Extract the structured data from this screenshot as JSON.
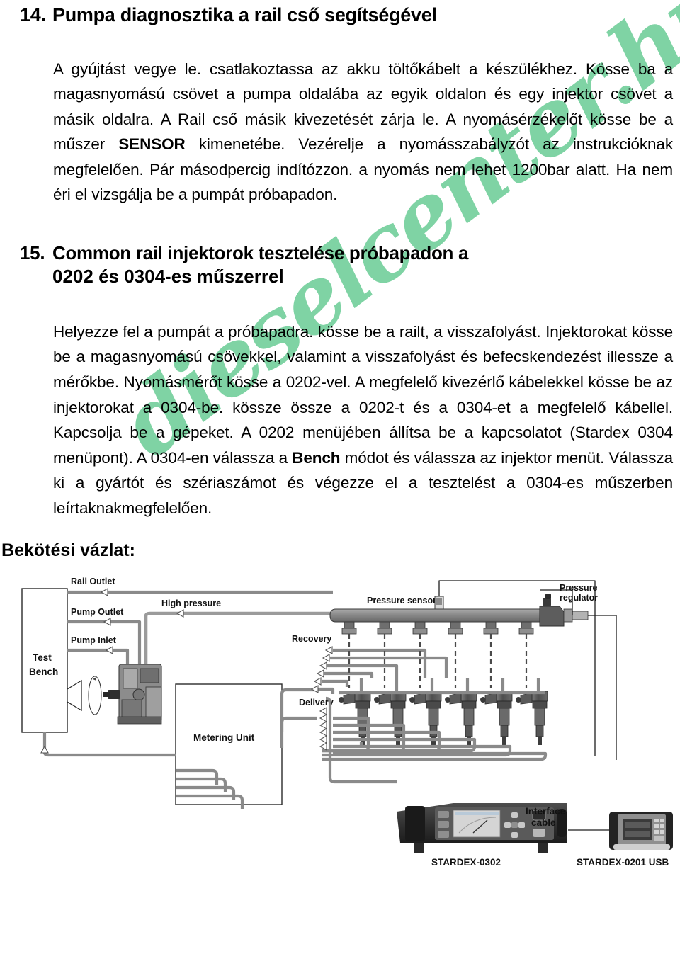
{
  "watermark": {
    "text": "dieselcenter.hu",
    "color": "#7fd3a4"
  },
  "sections": [
    {
      "number": "14.",
      "title": "Pumpa diagnosztika a rail cső segítségével",
      "paragraphs": [
        "A gyújtást vegye le. csatlakoztassa az akku töltőkábelt a készülékhez. Kösse ba a magasnyomású csövet a pumpa oldalába az egyik oldalon és egy injektor csövet a másik oldalra. A Rail cső másik kivezetését zárja le.",
        "A nyomásérzékelőt kösse be a műszer SENSOR kimenetébe. Vezérelje a nyomásszabályzót az instrukcióknak megfelelően. Pár másodpercig indítózzon. a nyomás nem lehet 1200bar alatt. Ha nem éri el vizsgálja be a pumpát próbapadon."
      ],
      "para_bold_term": "SENSOR"
    },
    {
      "number": "15.",
      "title_line1": "Common rail injektorok tesztelése próbapadon a",
      "title_line2": "0202 és 0304-es műszerrel",
      "paragraph": "Helyezze fel a pumpát a próbapadra. kösse be a railt, a visszafolyást. Injektorokat kösse be a magasnyomású csövekkel, valamint a visszafolyást és befecskendezést illessze a mérőkbe. Nyomásmérőt kösse a 0202-vel. A megfelelő kivezérlő kábelekkel kösse be az injektorokat a 0304-be. kössze össze a 0202-t és a 0304-et a megfelelő kábellel. Kapcsolja be a gépeket. A 0202 menüjében állítsa be a kapcsolatot (Stardex 0304 menüpont). A 0304-en válassza a Bench módot és válassza az injektor menüt. Válassza ki a gyártót és szériaszámot és végezze el a tesztelést a 0304-es műszerben leírtaknakmegfelelően.",
      "para_bold_term": "Bench"
    }
  ],
  "heading_14_number": "14.",
  "heading_14_title": "Pumpa diagnosztika a rail cső segítségével",
  "heading_15_number": "15.",
  "heading_15_title_l1": "Common rail injektorok tesztelése próbapadon a",
  "heading_15_title_l2": "0202 és 0304-es műszerrel",
  "para_14_a_part1": "A gyújtást vegye le. csatlakoztassa az akku töltőkábelt a készülékhez. Kösse ba a magasnyomású csövet a pumpa oldalába az egyik oldalon és egy injektor csövet a másik oldalra. A Rail cső másik kivezetését zárja le. A nyomásérzékelőt kösse be a műszer ",
  "para_14_a_bold": "SENSOR",
  "para_14_a_part2": " kimenetébe. Vezérelje a nyomásszabályzót az instrukcióknak megfelelően. Pár másodpercig indítózzon. a nyomás nem lehet 1200bar alatt. Ha nem éri el vizsgálja be a pumpát próbapadon.",
  "para_15_part1": "Helyezze fel a pumpát a próbapadra. kösse be a railt, a visszafolyást. Injektorokat kösse be a magasnyomású csövekkel, valamint a visszafolyást és befecskendezést illessze a mérőkbe. Nyomásmérőt kösse a 0202-vel. A megfelelő kivezérlő kábelekkel kösse be az injektorokat a 0304-be. kössze össze a 0202-t és a 0304-et a megfelelő kábellel. Kapcsolja be a gépeket. A 0202 menüjében állítsa be a kapcsolatot (Stardex 0304 menüpont). A 0304-en válassza a ",
  "para_15_bold": "Bench",
  "para_15_part2": " módot és válassza az injektor menüt. Válassza ki a gyártót és szériaszámot és végezze el a tesztelést a 0304-es műszerben leírtaknakmegfelelően.",
  "schematic_label": "Bekötési vázlat:",
  "diagram": {
    "labels": {
      "test_bench_l1": "Test",
      "test_bench_l2": "Bench",
      "rail_outlet": "Rail Outlet",
      "pump_outlet": "Pump Outlet",
      "pump_inlet": "Pump Inlet",
      "high_pressure": "High pressure",
      "pressure_sensor": "Pressure sensor",
      "pressure_regulator_l1": "Pressure",
      "pressure_regulator_l2": "regulator",
      "recovery": "Recovery",
      "delivery": "Delivery",
      "metering_unit": "Metering Unit",
      "interface_cable_l1": "Interface",
      "interface_cable_l2": "cable",
      "device_left": "STARDEX-0302",
      "device_right": "STARDEX-0201 USB"
    },
    "injector_count": 6,
    "rail_port_count": 6
  }
}
